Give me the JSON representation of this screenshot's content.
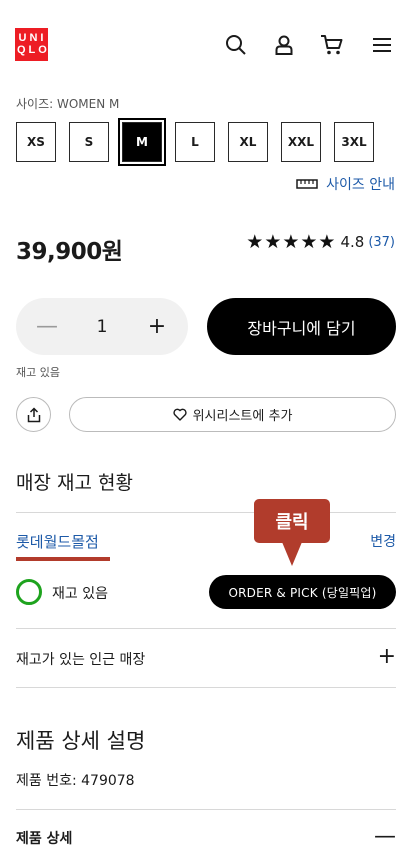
{
  "header": {
    "logo": [
      "UNI",
      "QLO"
    ],
    "icons": [
      "search-icon",
      "account-icon",
      "cart-icon",
      "menu-icon"
    ]
  },
  "size": {
    "label": "사이즈: WOMEN M",
    "options": [
      "XS",
      "S",
      "M",
      "L",
      "XL",
      "XXL",
      "3XL"
    ],
    "selected": "M",
    "guide_label": "사이즈 안내"
  },
  "price": "39,900원",
  "rating": {
    "stars": "★★★★★",
    "score": "4.8",
    "count": "(37)"
  },
  "quantity": {
    "value": "1",
    "minus": "—",
    "plus": "+"
  },
  "cart_button": "장바구니에 담기",
  "stock_note": "재고 있음",
  "wishlist_button": "위시리스트에 추가",
  "store_stock": {
    "title": "매장 재고 현황",
    "store_name": "롯데월드몰점",
    "change_label": "변경",
    "tooltip": "클릭",
    "status": "재고 있음",
    "pickup_button": "ORDER & PICK (당일픽업)",
    "nearby_label": "재고가 있는 인근 매장",
    "nearby_icon": "+"
  },
  "product_detail": {
    "title": "제품 상세 설명",
    "product_number": "제품 번호: 479078",
    "detail_label": "제품 상세",
    "detail_icon": "—"
  },
  "colors": {
    "brand_red": "#ed1d24",
    "link_blue": "#1d5aa8",
    "tooltip_red": "#b13c2c",
    "stock_green": "#1ea31e"
  }
}
